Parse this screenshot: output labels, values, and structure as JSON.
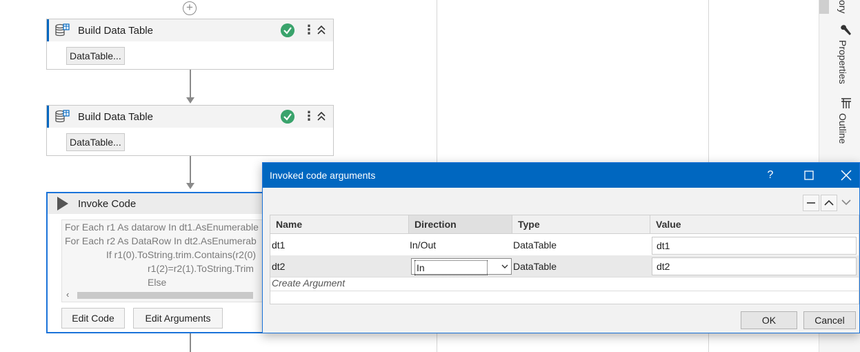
{
  "workflow": {
    "activities": [
      {
        "title": "Build Data Table",
        "button": "DataTable..."
      },
      {
        "title": "Build Data Table",
        "button": "DataTable..."
      }
    ],
    "invoke_code": {
      "title": "Invoke Code",
      "code_lines": [
        "For Each r1 As datarow In dt1.AsEnumerable",
        "For Each r2 As DataRow In dt2.AsEnumerab",
        "If r1(0).ToString.trim.Contains(r2(0)",
        "r1(2)=r2(1).ToString.Trim",
        "Else"
      ],
      "edit_code_label": "Edit Code",
      "edit_arguments_label": "Edit Arguments"
    }
  },
  "side_panel": {
    "tabs": [
      "ory",
      "Properties",
      "Outline"
    ]
  },
  "dialog": {
    "title": "Invoked code arguments",
    "help": "?",
    "columns": [
      "Name",
      "Direction",
      "Type",
      "Value"
    ],
    "rows": [
      {
        "name": "dt1",
        "direction": "In/Out",
        "type": "DataTable",
        "value": "dt1"
      },
      {
        "name": "dt2",
        "direction": "In",
        "type": "DataTable",
        "value": "dt2"
      }
    ],
    "create_argument": "Create Argument",
    "ok_label": "OK",
    "cancel_label": "Cancel"
  },
  "colors": {
    "accent": "#0067c0",
    "success": "#3aa36c"
  }
}
